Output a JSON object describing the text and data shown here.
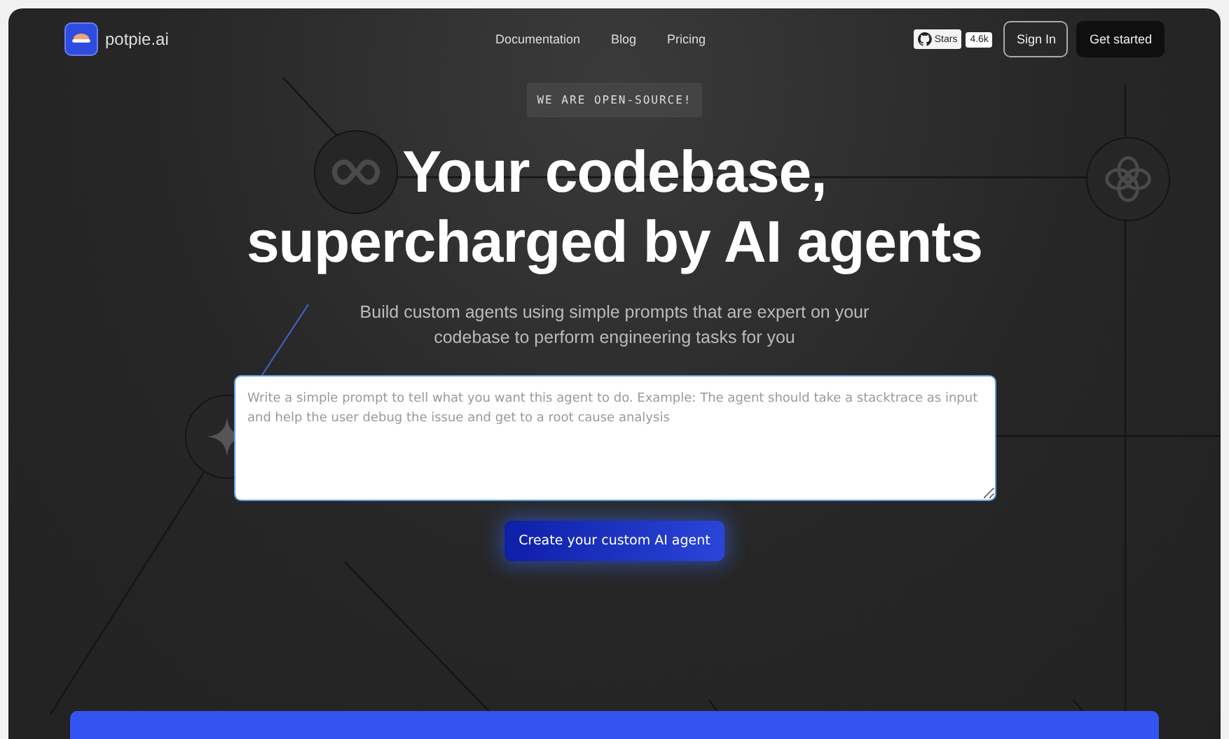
{
  "brand": {
    "name": "potpie",
    "suffix": ".ai"
  },
  "nav": [
    "Documentation",
    "Blog",
    "Pricing"
  ],
  "github": {
    "label": "Stars",
    "count": "4.6k"
  },
  "actions": [
    {
      "label": "Sign In",
      "kind": "outline"
    },
    {
      "label": "Get started",
      "kind": "solid"
    }
  ],
  "badge": "WE ARE OPEN-SOURCE!",
  "headline": [
    "Your codebase,",
    "supercharged by AI agents"
  ],
  "subtitle": "Build custom agents using simple prompts that are expert on your codebase to perform engineering tasks for you",
  "prompt": {
    "placeholder": "Write a simple prompt to tell what you want this agent to do. Example: The agent should take a stacktrace as input and help the user debug the issue and get to a root cause analysis"
  },
  "cta": "Create your custom AI agent"
}
